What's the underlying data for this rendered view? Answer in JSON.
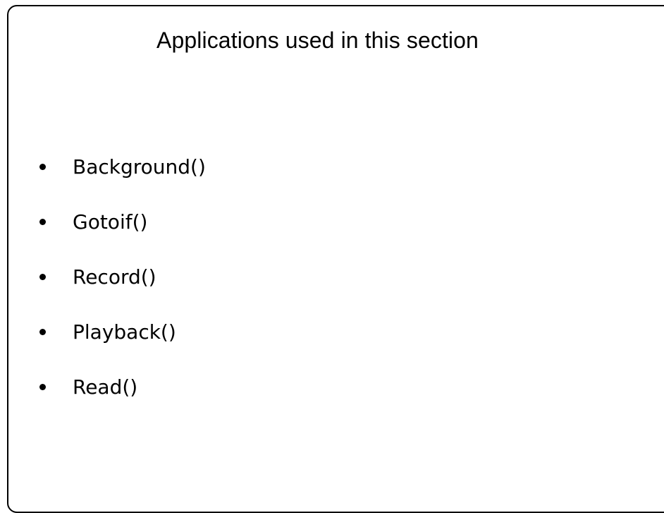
{
  "slide": {
    "title": "Applications used in this section",
    "items": [
      "Background()",
      "Gotoif()",
      "Record()",
      "Playback()",
      "Read()"
    ]
  },
  "colors": {
    "text": "#000000",
    "border": "#000000",
    "background": "#ffffff"
  }
}
